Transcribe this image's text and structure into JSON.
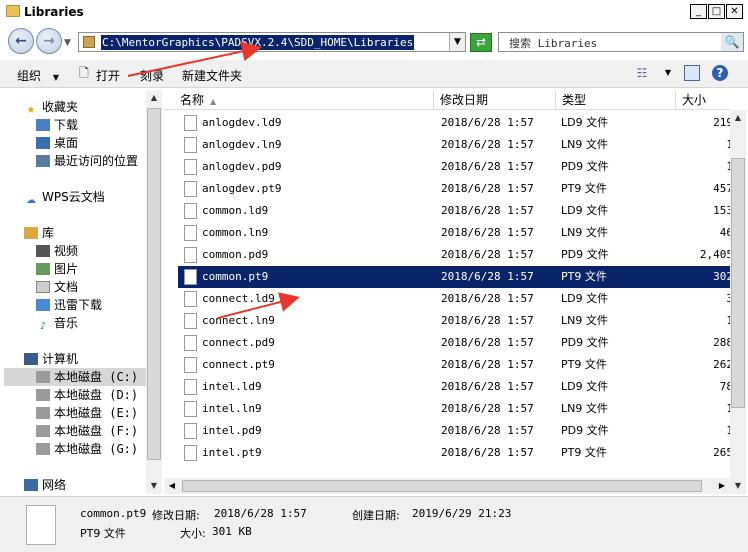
{
  "window": {
    "title": "Libraries"
  },
  "address_bar": {
    "path": "C:\\MentorGraphics\\PADSVX.2.4\\SDD_HOME\\Libraries",
    "search_placeholder": "搜索 Libraries"
  },
  "toolbar": {
    "organize": "组织",
    "open": "打开",
    "burn": "刻录",
    "new_folder": "新建文件夹"
  },
  "nav": {
    "favorites": "收藏夹",
    "downloads": "下载",
    "desktop": "桌面",
    "recent": "最近访问的位置",
    "wps": "WPS云文档",
    "libraries": "库",
    "videos": "视频",
    "pictures": "图片",
    "documents": "文档",
    "xunlei": "迅雷下载",
    "music": "音乐",
    "computer": "计算机",
    "drives": [
      "本地磁盘 (C:)",
      "本地磁盘 (D:)",
      "本地磁盘 (E:)",
      "本地磁盘 (F:)",
      "本地磁盘 (G:)"
    ],
    "network": "网络"
  },
  "columns": {
    "name": "名称",
    "date": "修改日期",
    "type": "类型",
    "size": "大小"
  },
  "files": [
    {
      "name": "anlogdev.ld9",
      "date": "2018/6/28 1:57",
      "type": "LD9 文件",
      "size": "219"
    },
    {
      "name": "anlogdev.ln9",
      "date": "2018/6/28 1:57",
      "type": "LN9 文件",
      "size": "1"
    },
    {
      "name": "anlogdev.pd9",
      "date": "2018/6/28 1:57",
      "type": "PD9 文件",
      "size": "1"
    },
    {
      "name": "anlogdev.pt9",
      "date": "2018/6/28 1:57",
      "type": "PT9 文件",
      "size": "457"
    },
    {
      "name": "common.ld9",
      "date": "2018/6/28 1:57",
      "type": "LD9 文件",
      "size": "153"
    },
    {
      "name": "common.ln9",
      "date": "2018/6/28 1:57",
      "type": "LN9 文件",
      "size": "46"
    },
    {
      "name": "common.pd9",
      "date": "2018/6/28 1:57",
      "type": "PD9 文件",
      "size": "2,405"
    },
    {
      "name": "common.pt9",
      "date": "2018/6/28 1:57",
      "type": "PT9 文件",
      "size": "302"
    },
    {
      "name": "connect.ld9",
      "date": "2018/6/28 1:57",
      "type": "LD9 文件",
      "size": "3"
    },
    {
      "name": "connect.ln9",
      "date": "2018/6/28 1:57",
      "type": "LN9 文件",
      "size": "1"
    },
    {
      "name": "connect.pd9",
      "date": "2018/6/28 1:57",
      "type": "PD9 文件",
      "size": "288"
    },
    {
      "name": "connect.pt9",
      "date": "2018/6/28 1:57",
      "type": "PT9 文件",
      "size": "262"
    },
    {
      "name": "intel.ld9",
      "date": "2018/6/28 1:57",
      "type": "LD9 文件",
      "size": "78"
    },
    {
      "name": "intel.ln9",
      "date": "2018/6/28 1:57",
      "type": "LN9 文件",
      "size": "1"
    },
    {
      "name": "intel.pd9",
      "date": "2018/6/28 1:57",
      "type": "PD9 文件",
      "size": "1"
    },
    {
      "name": "intel.pt9",
      "date": "2018/6/28 1:57",
      "type": "PT9 文件",
      "size": "265"
    }
  ],
  "selected_file": "common.pt9",
  "details": {
    "filename": "common.pt9",
    "modified_label": "修改日期:",
    "modified": "2018/6/28 1:57",
    "created_label": "创建日期:",
    "created": "2019/6/29 21:23",
    "type": "PT9 文件",
    "size_label": "大小:",
    "size": "301 KB"
  },
  "colors": {
    "selection": "#0a246a",
    "annotation_arrow": "#e8372c"
  }
}
